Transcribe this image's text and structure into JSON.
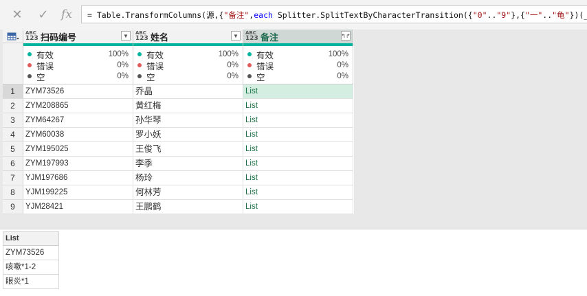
{
  "formula_bar": {
    "cancel_icon": "close-icon",
    "commit_icon": "check-icon",
    "fx_label": "fx",
    "formula": {
      "p1": "= Table.TransformColumns(源,{",
      "s1": "\"备注\"",
      "p2": ",",
      "kw": "each",
      "p3": " Splitter.SplitTextByCharacterTransition({",
      "s2": "\"0\"",
      "p4": "..",
      "s3": "\"9\"",
      "p5": "},{",
      "s4": "\"一\"",
      "p6": "..",
      "s5": "\"龟\"",
      "p7": "})(_)})"
    }
  },
  "grid": {
    "columns": [
      {
        "badge_top": "ABC",
        "badge_bottom": "123",
        "label": "扫码编号",
        "selected": false
      },
      {
        "badge_top": "ABC",
        "badge_bottom": "123",
        "label": "姓名",
        "selected": false
      },
      {
        "badge_top": "ABC",
        "badge_bottom": "123",
        "label": "备注",
        "selected": true
      }
    ],
    "quality": {
      "labels": {
        "valid": "有效",
        "error": "错误",
        "empty": "空"
      },
      "values": [
        {
          "valid": "100%",
          "error": "0%",
          "empty": "0%"
        },
        {
          "valid": "100%",
          "error": "0%",
          "empty": "0%"
        },
        {
          "valid": "100%",
          "error": "0%",
          "empty": "0%"
        }
      ],
      "colors": {
        "valid": "#00b39e",
        "error": "#e05a5a",
        "empty": "#555555",
        "strip": "#00b39e"
      }
    },
    "rows": [
      {
        "n": "1",
        "id": "ZYM73526",
        "name": "乔晶",
        "note": "List"
      },
      {
        "n": "2",
        "id": "ZYM208865",
        "name": "黄红梅",
        "note": "List"
      },
      {
        "n": "3",
        "id": "ZYM64267",
        "name": "孙华琴",
        "note": "List"
      },
      {
        "n": "4",
        "id": "ZYM60038",
        "name": "罗小妖",
        "note": "List"
      },
      {
        "n": "5",
        "id": "ZYM195025",
        "name": "王俊飞",
        "note": "List"
      },
      {
        "n": "6",
        "id": "ZYM197993",
        "name": "李季",
        "note": "List"
      },
      {
        "n": "7",
        "id": "YJM197686",
        "name": "杨玲",
        "note": "List"
      },
      {
        "n": "8",
        "id": "YJM199225",
        "name": "何林芳",
        "note": "List"
      },
      {
        "n": "9",
        "id": "YJM28421",
        "name": "王鹏鹤",
        "note": "List"
      }
    ],
    "selected_row": 1
  },
  "preview": {
    "header": "List",
    "items": [
      "ZYM73526",
      "咳嗽*1-2",
      "眼炎*1"
    ]
  }
}
